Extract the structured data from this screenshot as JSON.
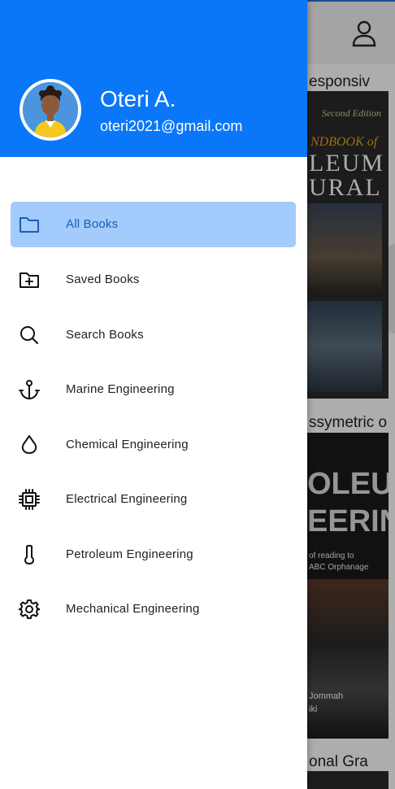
{
  "user": {
    "name": "Oteri A.",
    "email": "oteri2021@gmail.com"
  },
  "menu": {
    "items": [
      {
        "label": "All Books",
        "icon": "folder-icon",
        "active": true
      },
      {
        "label": "Saved Books",
        "icon": "folder-plus-icon",
        "active": false
      },
      {
        "label": "Search Books",
        "icon": "search-icon",
        "active": false
      },
      {
        "label": "Marine Engineering",
        "icon": "anchor-icon",
        "active": false
      },
      {
        "label": "Chemical Engineering",
        "icon": "droplet-icon",
        "active": false
      },
      {
        "label": "Electrical Engineering",
        "icon": "chip-icon",
        "active": false
      },
      {
        "label": "Petroleum Engineering",
        "icon": "thermometer-icon",
        "active": false
      },
      {
        "label": "Mechanical Engineering",
        "icon": "gear-icon",
        "active": false
      }
    ]
  },
  "background": {
    "profile_icon": "person-icon",
    "books": [
      {
        "title_fragment": "esponsiv",
        "cover_lines": [
          "Second Edition",
          "NDBOOK of",
          "LEUM",
          "URAL"
        ]
      },
      {
        "title_fragment": "ssymetric o",
        "cover_lines": [
          "OLEUM",
          "EERING",
          "of reading to",
          "ABC Orphanage",
          "Jommah",
          "iki"
        ]
      },
      {
        "title_fragment": "onal Gra"
      }
    ]
  },
  "colors": {
    "primary": "#0a77f8",
    "active_item_bg": "#a3cbfb",
    "active_item_text": "#1a5fb4"
  }
}
